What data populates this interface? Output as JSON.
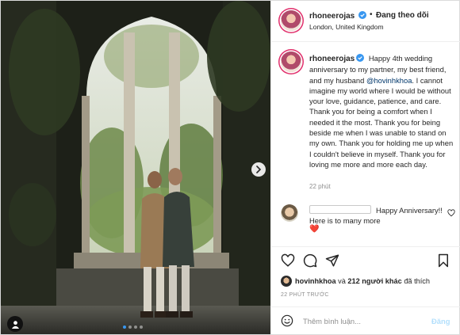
{
  "post": {
    "author": {
      "username": "rhoneerojas",
      "follow_state": "Đang theo dõi",
      "separator": "•",
      "location": "London, United Kingdom"
    },
    "caption": {
      "before_mention": "Happy 4th wedding anniversary to my partner, my best friend, and my husband",
      "mention": "@hovinhkhoa",
      "after_mention": ". I cannot imagine my world where I would be without your love, guidance, patience, and care. Thank you for being a comfort when I needed it the most. Thank you for being beside me when I was unable to stand on my own. Thank you for holding me up when I couldn't believe in myself. Thank you for loving me more and more each day.",
      "time_ago": "22 phút"
    },
    "comment": {
      "text": "Happy Anniversary!! Here is to many more",
      "emoji": "❤️"
    },
    "likes": {
      "liker": "hovinhkhoa",
      "connector": "và",
      "others": "212 người khác",
      "suffix": "đã thích"
    },
    "posted_age": "22 PHÚT TRƯỚC",
    "composer": {
      "placeholder": "Thêm bình luận...",
      "post_label": "Đăng"
    },
    "carousel": {
      "slides": 4,
      "active_index": 0
    }
  },
  "icons": {
    "verified": "verified-badge-icon",
    "like": "heart-icon",
    "comment": "comment-icon",
    "share": "paper-plane-icon",
    "save": "bookmark-icon",
    "emoji": "smiley-icon",
    "next": "chevron-right-icon",
    "tag": "user-tag-icon"
  },
  "colors": {
    "verified": "#3897f0",
    "mention": "#00376b",
    "post_disabled": "#b2dffc",
    "heart": "#ed4956"
  }
}
